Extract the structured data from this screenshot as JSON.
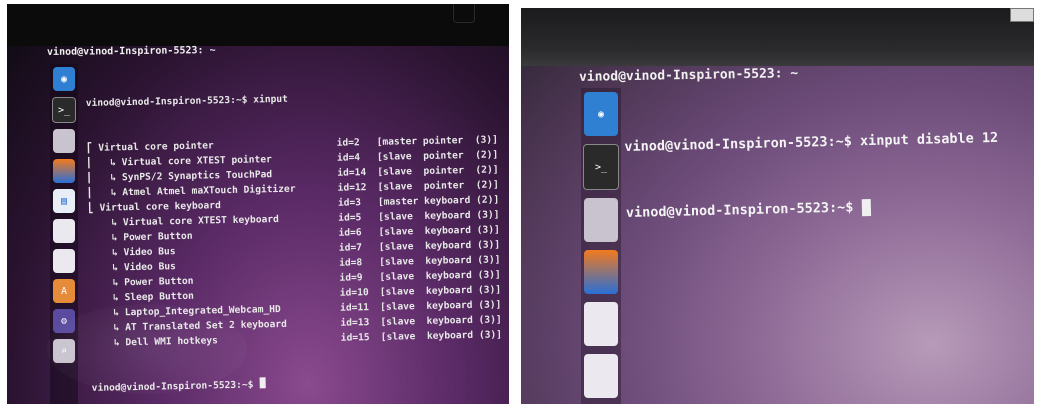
{
  "left_photo": {
    "title": "vinod@vinod-Inspiron-5523: ~",
    "command_line": "vinod@vinod-Inspiron-5523:~$ xinput",
    "devices": [
      {
        "name": "⎡ Virtual core pointer",
        "id": "id=2",
        "type": "[master pointer  (3)]"
      },
      {
        "name": "⎜   ↳ Virtual core XTEST pointer",
        "id": "id=4",
        "type": "[slave  pointer  (2)]"
      },
      {
        "name": "⎜   ↳ SynPS/2 Synaptics TouchPad",
        "id": "id=14",
        "type": "[slave  pointer  (2)]"
      },
      {
        "name": "⎜   ↳ Atmel Atmel maXTouch Digitizer",
        "id": "id=12",
        "type": "[slave  pointer  (2)]"
      },
      {
        "name": "⎣ Virtual core keyboard",
        "id": "id=3",
        "type": "[master keyboard (2)]"
      },
      {
        "name": "    ↳ Virtual core XTEST keyboard",
        "id": "id=5",
        "type": "[slave  keyboard (3)]"
      },
      {
        "name": "    ↳ Power Button",
        "id": "id=6",
        "type": "[slave  keyboard (3)]"
      },
      {
        "name": "    ↳ Video Bus",
        "id": "id=7",
        "type": "[slave  keyboard (3)]"
      },
      {
        "name": "    ↳ Video Bus",
        "id": "id=8",
        "type": "[slave  keyboard (3)]"
      },
      {
        "name": "    ↳ Power Button",
        "id": "id=9",
        "type": "[slave  keyboard (3)]"
      },
      {
        "name": "    ↳ Sleep Button",
        "id": "id=10",
        "type": "[slave  keyboard (3)]"
      },
      {
        "name": "    ↳ Laptop_Integrated_Webcam_HD",
        "id": "id=11",
        "type": "[slave  keyboard (3)]"
      },
      {
        "name": "    ↳ AT Translated Set 2 keyboard",
        "id": "id=13",
        "type": "[slave  keyboard (3)]"
      },
      {
        "name": "    ↳ Dell WMI hotkeys",
        "id": "id=15",
        "type": "[slave  keyboard (3)]"
      }
    ],
    "prompt": "vinod@vinod-Inspiron-5523:~$ ",
    "launcher_icons": [
      "ubuntu-dash-icon",
      "terminal-icon",
      "files-icon",
      "firefox-icon",
      "writer-icon",
      "calc-icon",
      "impress-icon",
      "software-center-icon",
      "settings-icon",
      "search-icon"
    ]
  },
  "right_photo": {
    "title": "vinod@vinod-Inspiron-5523: ~",
    "line1": "vinod@vinod-Inspiron-5523:~$ xinput disable 12",
    "prompt": "vinod@vinod-Inspiron-5523:~$ ",
    "launcher_icons": [
      "ubuntu-dash-icon",
      "terminal-icon",
      "files-icon",
      "firefox-icon",
      "writer-icon",
      "calc-icon"
    ]
  },
  "colors": {
    "terminal_bg": "#3b1a3f",
    "text": "#e8e8e8",
    "launcher_blue": "#2f7fd2"
  }
}
